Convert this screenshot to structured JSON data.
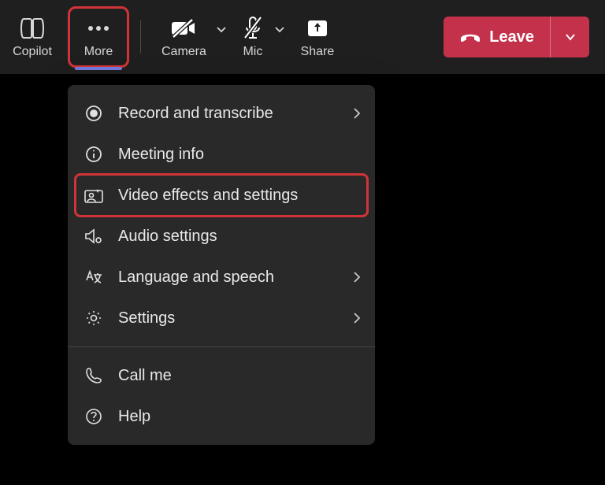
{
  "toolbar": {
    "copilot_label": "Copilot",
    "more_label": "More",
    "camera_label": "Camera",
    "mic_label": "Mic",
    "share_label": "Share",
    "leave_label": "Leave"
  },
  "menu": {
    "items": [
      {
        "label": "Record and transcribe",
        "icon": "record-icon",
        "chevron": true
      },
      {
        "label": "Meeting info",
        "icon": "info-icon",
        "chevron": false
      },
      {
        "label": "Video effects and settings",
        "icon": "video-effects-icon",
        "chevron": false,
        "highlighted": true
      },
      {
        "label": "Audio settings",
        "icon": "audio-settings-icon",
        "chevron": false
      },
      {
        "label": "Language and speech",
        "icon": "language-icon",
        "chevron": true
      },
      {
        "label": "Settings",
        "icon": "settings-icon",
        "chevron": true
      }
    ],
    "items2": [
      {
        "label": "Call me",
        "icon": "phone-icon",
        "chevron": false
      },
      {
        "label": "Help",
        "icon": "help-icon",
        "chevron": false
      }
    ]
  }
}
